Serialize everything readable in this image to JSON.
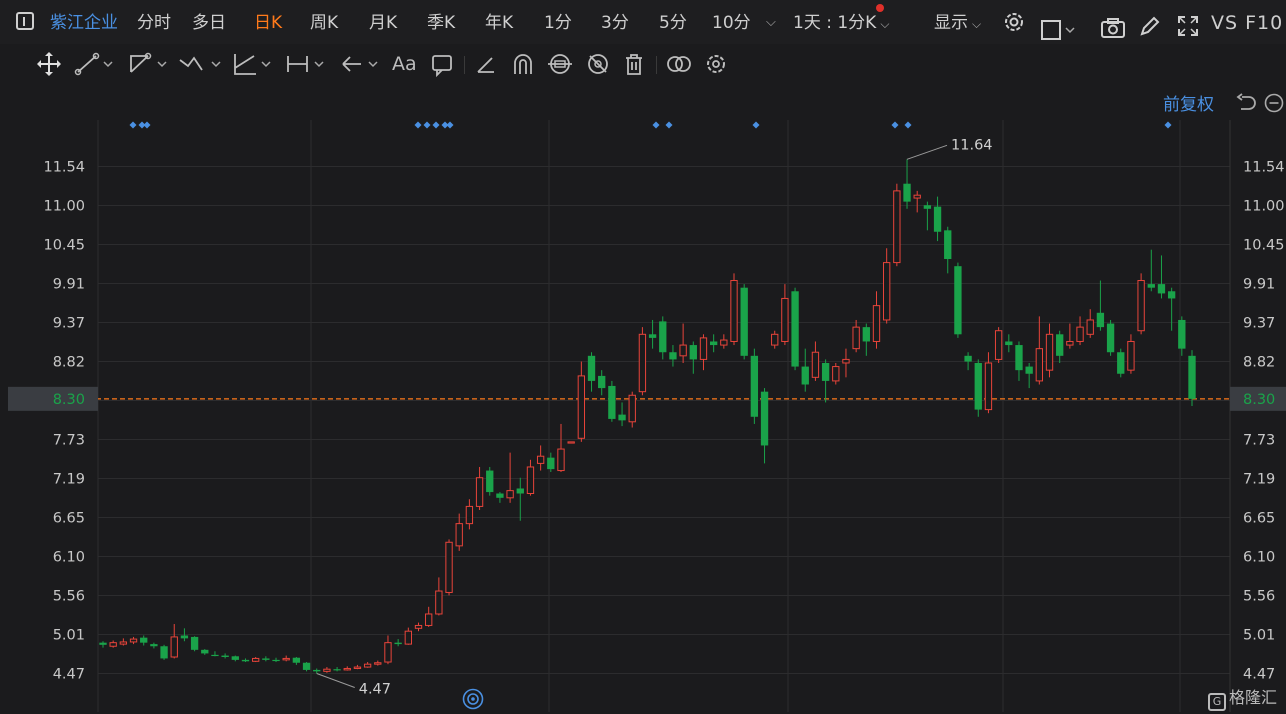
{
  "header": {
    "stock_name": "紫江企业",
    "tabs": [
      "分时",
      "多日",
      "日K",
      "周K",
      "月K",
      "季K",
      "年K",
      "1分",
      "3分",
      "5分",
      "10分"
    ],
    "active_tab": "日K",
    "interval_label": "1天 : 1分K",
    "display_label": "显示",
    "vs_label": "VS F10"
  },
  "chart_header": {
    "adjust_label": "前复权"
  },
  "watermark": {
    "text": "格隆汇",
    "logo_letter": "G"
  },
  "colors": {
    "up": "#e8443a",
    "down": "#1aa34a",
    "accent": "#ff7a1a",
    "blue": "#4a90e2",
    "grid": "#2c2c2e",
    "background": "#1b1b1d"
  },
  "chart_data": {
    "type": "candlestick",
    "y_ticks": [
      "11.54",
      "11.00",
      "10.45",
      "9.91",
      "9.37",
      "8.82",
      "8.30",
      "7.73",
      "7.19",
      "6.65",
      "6.10",
      "5.56",
      "5.01",
      "4.47"
    ],
    "ylim": [
      4.3,
      11.9
    ],
    "current_price": "8.30",
    "annotations": {
      "high": "11.64",
      "low": "4.47"
    },
    "candles": [
      [
        4.9,
        4.87,
        4.92,
        4.83
      ],
      [
        4.85,
        4.9,
        4.93,
        4.83
      ],
      [
        4.88,
        4.91,
        4.96,
        4.86
      ],
      [
        4.91,
        4.95,
        4.98,
        4.88
      ],
      [
        4.97,
        4.9,
        5.0,
        4.86
      ],
      [
        4.88,
        4.85,
        4.9,
        4.82
      ],
      [
        4.85,
        4.68,
        4.87,
        4.66
      ],
      [
        4.7,
        4.98,
        5.16,
        4.68
      ],
      [
        5.0,
        4.96,
        5.1,
        4.92
      ],
      [
        4.98,
        4.8,
        4.99,
        4.78
      ],
      [
        4.8,
        4.75,
        4.81,
        4.73
      ],
      [
        4.73,
        4.72,
        4.78,
        4.71
      ],
      [
        4.72,
        4.7,
        4.75,
        4.68
      ],
      [
        4.71,
        4.66,
        4.72,
        4.64
      ],
      [
        4.66,
        4.64,
        4.68,
        4.63
      ],
      [
        4.64,
        4.68,
        4.7,
        4.63
      ],
      [
        4.68,
        4.66,
        4.71,
        4.64
      ],
      [
        4.66,
        4.65,
        4.69,
        4.63
      ],
      [
        4.66,
        4.68,
        4.72,
        4.64
      ],
      [
        4.69,
        4.62,
        4.7,
        4.59
      ],
      [
        4.62,
        4.52,
        4.63,
        4.5
      ],
      [
        4.52,
        4.5,
        4.54,
        4.47
      ],
      [
        4.5,
        4.53,
        4.56,
        4.48
      ],
      [
        4.53,
        4.52,
        4.56,
        4.5
      ],
      [
        4.52,
        4.54,
        4.57,
        4.51
      ],
      [
        4.54,
        4.56,
        4.59,
        4.53
      ],
      [
        4.56,
        4.6,
        4.63,
        4.55
      ],
      [
        4.6,
        4.62,
        4.65,
        4.58
      ],
      [
        4.63,
        4.9,
        5.0,
        4.6
      ],
      [
        4.9,
        4.88,
        4.95,
        4.85
      ],
      [
        4.88,
        5.06,
        5.11,
        4.87
      ],
      [
        5.1,
        5.14,
        5.18,
        5.06
      ],
      [
        5.14,
        5.3,
        5.4,
        5.12
      ],
      [
        5.3,
        5.62,
        5.81,
        5.28
      ],
      [
        5.6,
        6.3,
        6.34,
        5.56
      ],
      [
        6.25,
        6.56,
        6.7,
        6.18
      ],
      [
        6.56,
        6.8,
        6.9,
        6.48
      ],
      [
        6.8,
        7.2,
        7.35,
        6.75
      ],
      [
        7.3,
        7.0,
        7.35,
        6.95
      ],
      [
        6.98,
        6.92,
        7.0,
        6.85
      ],
      [
        6.92,
        7.02,
        7.55,
        6.85
      ],
      [
        7.05,
        6.98,
        7.2,
        6.6
      ],
      [
        6.98,
        7.35,
        7.45,
        6.95
      ],
      [
        7.4,
        7.5,
        7.65,
        7.3
      ],
      [
        7.48,
        7.32,
        7.55,
        7.28
      ],
      [
        7.3,
        7.6,
        7.95,
        7.28
      ],
      [
        7.7,
        7.7,
        7.7,
        7.7
      ],
      [
        7.75,
        8.62,
        8.82,
        7.7
      ],
      [
        8.9,
        8.55,
        8.95,
        8.4
      ],
      [
        8.62,
        8.45,
        8.7,
        8.35
      ],
      [
        8.48,
        8.02,
        8.55,
        7.98
      ],
      [
        8.08,
        8.0,
        8.25,
        7.92
      ],
      [
        7.98,
        8.35,
        8.4,
        7.9
      ],
      [
        8.4,
        9.2,
        9.3,
        8.35
      ],
      [
        9.2,
        9.15,
        9.4,
        9.0
      ],
      [
        9.38,
        8.95,
        9.45,
        8.85
      ],
      [
        8.95,
        8.85,
        9.05,
        8.75
      ],
      [
        8.9,
        9.05,
        9.35,
        8.8
      ],
      [
        9.05,
        8.85,
        9.1,
        8.65
      ],
      [
        8.85,
        9.15,
        9.2,
        8.7
      ],
      [
        9.1,
        9.05,
        9.2,
        8.95
      ],
      [
        9.05,
        9.12,
        9.2,
        9.0
      ],
      [
        9.1,
        9.95,
        10.05,
        9.05
      ],
      [
        9.85,
        8.9,
        9.9,
        8.85
      ],
      [
        8.9,
        8.05,
        9.0,
        7.95
      ],
      [
        8.4,
        7.65,
        8.45,
        7.4
      ],
      [
        9.05,
        9.2,
        9.25,
        9.0
      ],
      [
        9.1,
        9.7,
        9.9,
        9.05
      ],
      [
        9.8,
        8.75,
        9.85,
        8.7
      ],
      [
        8.75,
        8.5,
        9.0,
        8.4
      ],
      [
        8.6,
        8.95,
        9.1,
        8.55
      ],
      [
        8.8,
        8.55,
        8.85,
        8.25
      ],
      [
        8.55,
        8.75,
        8.8,
        8.5
      ],
      [
        8.8,
        8.85,
        9.0,
        8.6
      ],
      [
        9.0,
        9.3,
        9.4,
        8.95
      ],
      [
        9.3,
        9.1,
        9.35,
        8.9
      ],
      [
        9.1,
        9.6,
        9.8,
        9.0
      ],
      [
        9.4,
        10.2,
        10.4,
        9.35
      ],
      [
        10.2,
        11.2,
        11.3,
        10.15
      ],
      [
        11.3,
        11.05,
        11.64,
        10.95
      ],
      [
        11.1,
        11.14,
        11.2,
        10.9
      ],
      [
        11.0,
        10.95,
        11.05,
        10.65
      ],
      [
        10.98,
        10.63,
        11.12,
        10.5
      ],
      [
        10.65,
        10.25,
        10.7,
        10.05
      ],
      [
        10.15,
        9.2,
        10.2,
        9.15
      ],
      [
        8.9,
        8.82,
        8.95,
        8.7
      ],
      [
        8.8,
        8.15,
        8.85,
        8.05
      ],
      [
        8.15,
        8.8,
        8.95,
        8.1
      ],
      [
        8.85,
        9.25,
        9.3,
        8.8
      ],
      [
        9.1,
        9.05,
        9.2,
        8.95
      ],
      [
        9.05,
        8.7,
        9.1,
        8.55
      ],
      [
        8.75,
        8.65,
        8.8,
        8.45
      ],
      [
        8.55,
        9.0,
        9.45,
        8.5
      ],
      [
        8.7,
        9.2,
        9.35,
        8.6
      ],
      [
        9.2,
        8.9,
        9.25,
        8.8
      ],
      [
        9.05,
        9.1,
        9.35,
        9.0
      ],
      [
        9.1,
        9.3,
        9.45,
        9.05
      ],
      [
        9.2,
        9.4,
        9.55,
        9.15
      ],
      [
        9.5,
        9.3,
        9.95,
        9.25
      ],
      [
        9.35,
        8.95,
        9.4,
        8.9
      ],
      [
        8.95,
        8.65,
        9.0,
        8.6
      ],
      [
        8.7,
        9.1,
        9.2,
        8.65
      ],
      [
        9.25,
        9.95,
        10.05,
        9.2
      ],
      [
        9.9,
        9.85,
        10.38,
        9.8
      ],
      [
        9.9,
        9.77,
        10.3,
        9.7
      ],
      [
        9.8,
        9.7,
        9.85,
        9.25
      ],
      [
        9.4,
        9.0,
        9.45,
        8.9
      ],
      [
        8.9,
        8.3,
        8.98,
        8.2
      ]
    ],
    "markers": [
      [
        133,
        1
      ],
      [
        142,
        1
      ],
      [
        147,
        1
      ],
      [
        418,
        1
      ],
      [
        427,
        1
      ],
      [
        436,
        1
      ],
      [
        445,
        1
      ],
      [
        450,
        1
      ],
      [
        656,
        1
      ],
      [
        669,
        1
      ],
      [
        756,
        1
      ],
      [
        895,
        1
      ],
      [
        908,
        1
      ],
      [
        1168,
        1
      ]
    ]
  }
}
